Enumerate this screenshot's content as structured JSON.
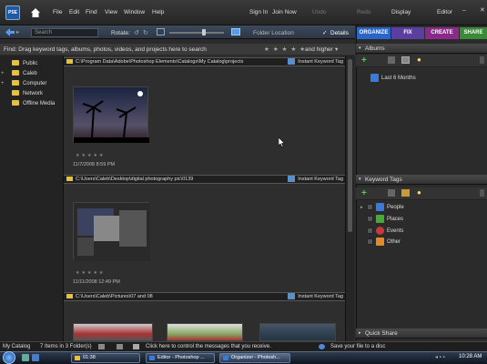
{
  "menubar": {
    "logo_text": "PSE",
    "items": [
      "File",
      "Edit",
      "Find",
      "View",
      "Window",
      "Help"
    ],
    "sign_in": "Sign In",
    "join_now": "Join Now",
    "undo": "Undo",
    "redo": "Redo",
    "display": "Display",
    "editor": "Editor"
  },
  "toolbar": {
    "search_placeholder": "Search",
    "rotate_label": "Rotate:",
    "folder_location": "Folder Location",
    "details": "Details"
  },
  "findbar": {
    "text": "Find: Drag keyword tags, albums, photos, videos, and projects here to search",
    "rating_suffix": "and higher"
  },
  "sidebar": {
    "folders": [
      "Public",
      "Caleb",
      "Computer",
      "Network",
      "Offline Media"
    ]
  },
  "groups": [
    {
      "path": "C:\\Program Data\\Adobe\\Photoshop Elements\\Catalogs\\My Catalog\\projects",
      "tag": "Instant Keyword Tag",
      "date": "11/7/2008 8:59 PM"
    },
    {
      "path": "C:\\Users\\Caleb\\Desktop\\digital photography pic\\0139",
      "tag": "Instant Keyword Tag",
      "date": "11/11/2008 12:49 PM"
    },
    {
      "path": "C:\\Users\\Caleb\\Pictures\\07 and 08",
      "tag": "Instant Keyword Tag"
    }
  ],
  "tabs": [
    {
      "label": "ORGANIZE",
      "color": "#2a66c8"
    },
    {
      "label": "FIX",
      "color": "#5a3fa0"
    },
    {
      "label": "CREATE",
      "color": "#8c2a8c"
    },
    {
      "label": "SHARE",
      "color": "#3a8a3a"
    }
  ],
  "albums": {
    "title": "Albums",
    "items": [
      "Last 6 Months"
    ]
  },
  "keywords": {
    "title": "Keyword Tags",
    "items": [
      {
        "label": "People",
        "color": "#3a7ad8"
      },
      {
        "label": "Places",
        "color": "#4aa83a"
      },
      {
        "label": "Events",
        "color": "#c83a3a"
      },
      {
        "label": "Other",
        "color": "#e08a2a"
      }
    ]
  },
  "quickshare": {
    "title": "Quick Share"
  },
  "status": {
    "catalog": "My Catalog",
    "count": "7 Items in 3 Folder(s)",
    "message": "Click here to control the messages that you receive.",
    "save": "Save your file to a disc"
  },
  "taskbar": {
    "buttons": [
      "01:38",
      "Editor - Photoshop ...",
      "Organizer - Photosh..."
    ],
    "time": "10:28 AM"
  }
}
